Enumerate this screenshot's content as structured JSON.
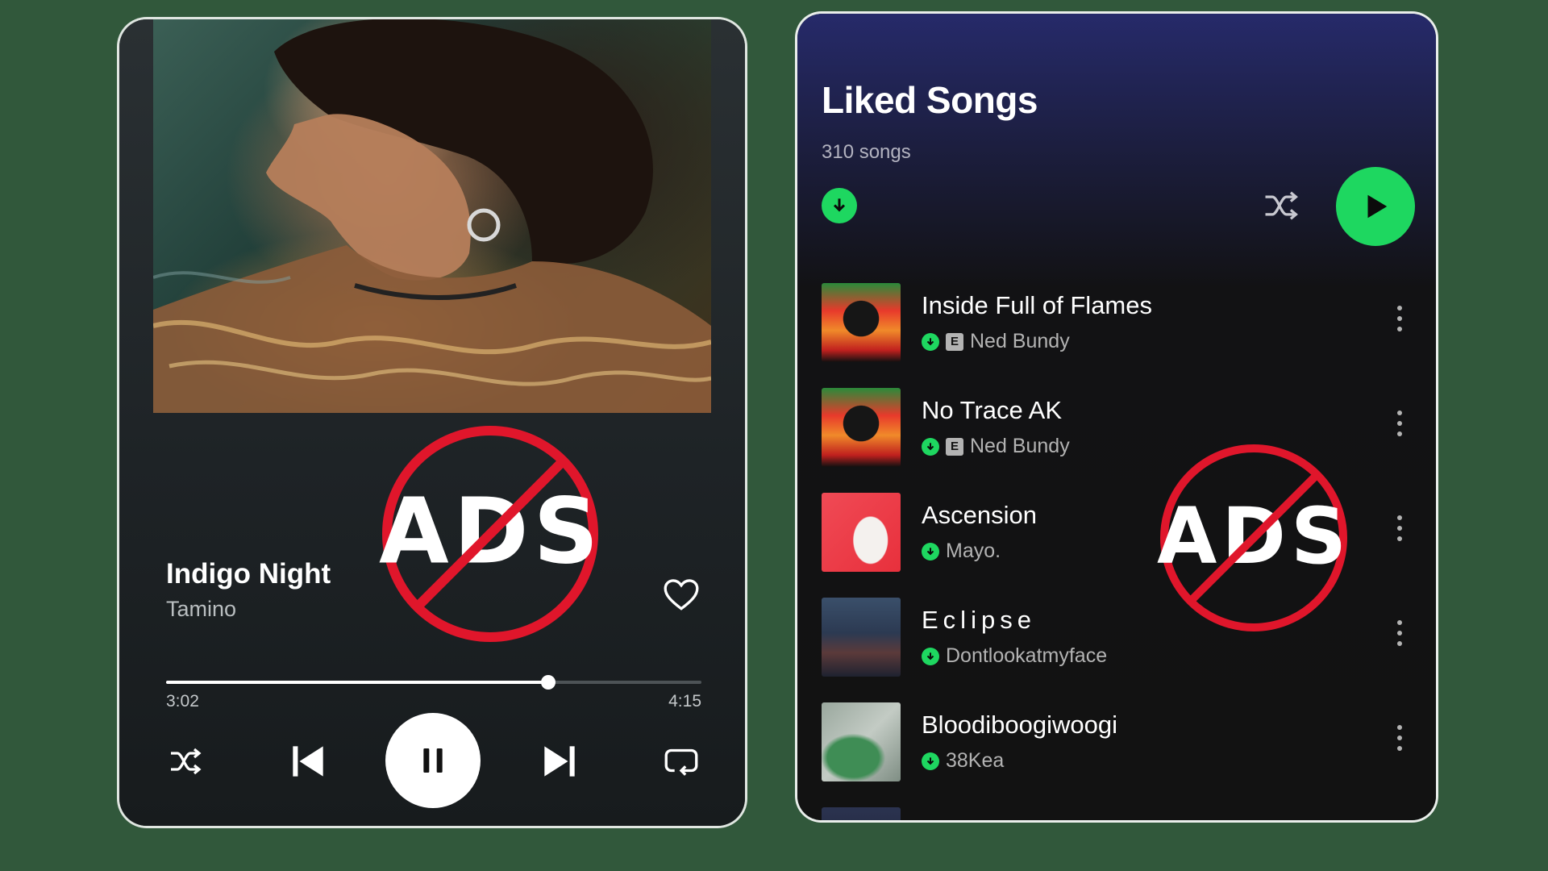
{
  "player": {
    "track_title": "Indigo Night",
    "track_artist": "Tamino",
    "elapsed": "3:02",
    "duration": "4:15",
    "progress_fraction": 0.714,
    "liked": false,
    "is_playing": true,
    "controls": [
      "shuffle-icon",
      "previous-icon",
      "pause-icon",
      "next-icon",
      "repeat-icon",
      "heart-icon"
    ]
  },
  "library": {
    "title": "Liked Songs",
    "count": "310 songs",
    "songs": [
      {
        "title": "Inside Full of Flames",
        "artist": "Ned Bundy",
        "explicit": "E",
        "downloaded": true
      },
      {
        "title": "No Trace AK",
        "artist": "Ned Bundy",
        "explicit": "E",
        "downloaded": true
      },
      {
        "title": "Ascension",
        "artist": "Mayo.",
        "downloaded": true
      },
      {
        "title": "Eclipse",
        "artist": "Dontlookatmyface",
        "downloaded": true
      },
      {
        "title": "Bloodiboogiwoogi",
        "artist": "38Kea",
        "downloaded": true
      }
    ]
  },
  "badges": {
    "left_text": "ADS",
    "right_text": "ADS"
  },
  "colors": {
    "background": "#31583b",
    "accent_green": "#1ed760",
    "badge_red": "#e0162b"
  }
}
